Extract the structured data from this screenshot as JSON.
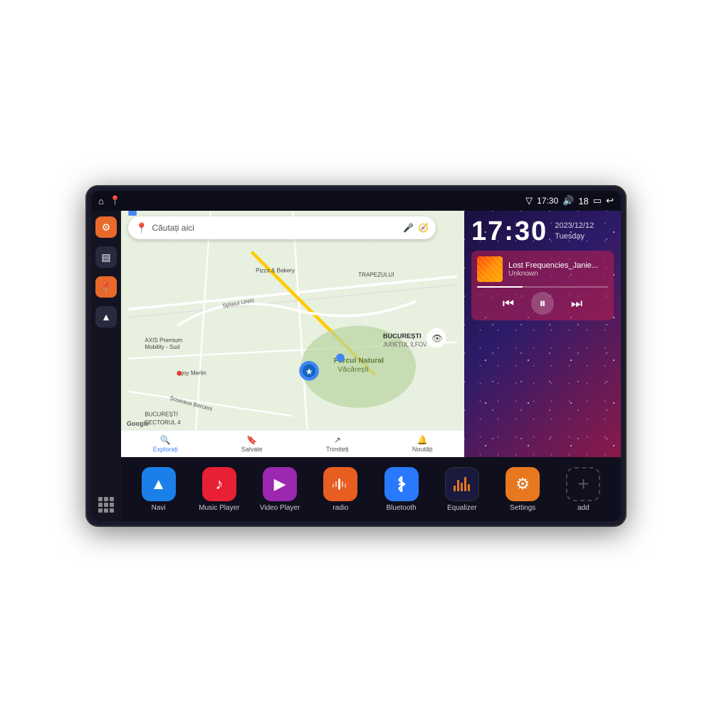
{
  "device": {
    "status_bar": {
      "wifi_icon": "▼",
      "time": "17:30",
      "volume_icon": "🔊",
      "battery_level": "18",
      "battery_icon": "🔋",
      "back_icon": "↩"
    },
    "sidebar": {
      "buttons": [
        {
          "id": "settings",
          "label": "Settings",
          "icon": "⚙",
          "color": "orange"
        },
        {
          "id": "files",
          "label": "Files",
          "icon": "▤",
          "color": "dark"
        },
        {
          "id": "maps",
          "label": "Maps",
          "icon": "📍",
          "color": "orange"
        },
        {
          "id": "navigation",
          "label": "Navigation",
          "icon": "▲",
          "color": "dark"
        }
      ]
    },
    "map": {
      "search_placeholder": "Căutați aici",
      "search_text": "Căutați aici",
      "locations": [
        "AXIS Premium Mobility - Sud",
        "Pizza & Bakery",
        "Parcul Natural Văcărești",
        "BUCUREȘTI",
        "SECTORUL 4",
        "JUDEȚUL ILFOV",
        "BERCENI",
        "TRAPEZULUI",
        "joy Merlin"
      ],
      "nav_items": [
        {
          "id": "explore",
          "label": "Explorați",
          "icon": "🔍",
          "active": true
        },
        {
          "id": "saved",
          "label": "Salvate",
          "icon": "🔖",
          "active": false
        },
        {
          "id": "send",
          "label": "Trimiteți",
          "icon": "↗",
          "active": false
        },
        {
          "id": "news",
          "label": "Noutăți",
          "icon": "🔔",
          "active": false
        }
      ]
    },
    "clock": {
      "time": "17:30",
      "date": "2023/12/12",
      "day": "Tuesday"
    },
    "music": {
      "title": "Lost Frequencies_Janie...",
      "artist": "Unknown",
      "progress": 35
    },
    "apps": [
      {
        "id": "navi",
        "label": "Navi",
        "color": "blue",
        "icon": "arrow"
      },
      {
        "id": "music",
        "label": "Music Player",
        "color": "red-music",
        "icon": "music"
      },
      {
        "id": "video",
        "label": "Video Player",
        "color": "purple-video",
        "icon": "video"
      },
      {
        "id": "radio",
        "label": "radio",
        "color": "orange-radio",
        "icon": "radio"
      },
      {
        "id": "bluetooth",
        "label": "Bluetooth",
        "color": "blue-bt",
        "icon": "bt"
      },
      {
        "id": "equalizer",
        "label": "Equalizer",
        "color": "dark-eq",
        "icon": "eq"
      },
      {
        "id": "settings",
        "label": "Settings",
        "color": "orange-settings",
        "icon": "gear"
      },
      {
        "id": "add",
        "label": "add",
        "color": "gray-add",
        "icon": "plus"
      }
    ]
  }
}
